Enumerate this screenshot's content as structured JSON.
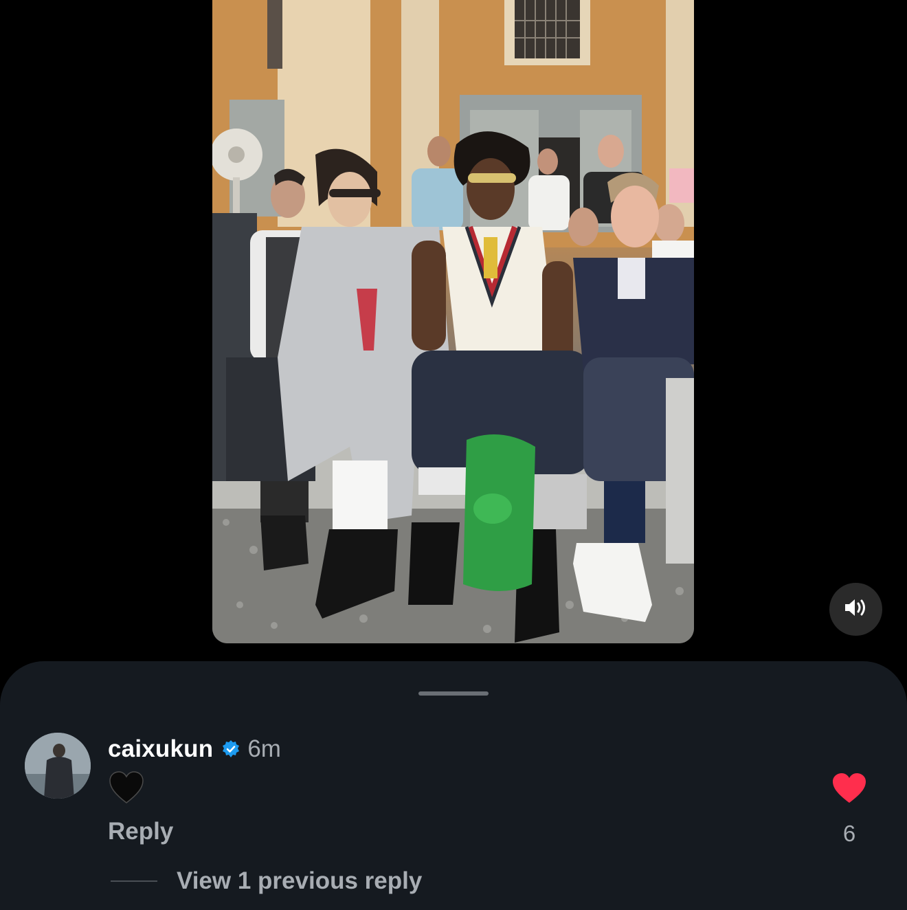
{
  "video": {
    "sound_icon": "speaker-on-icon"
  },
  "comment": {
    "username": "caixukun",
    "verified_icon": "verified-badge-icon",
    "time": "6m",
    "text_icon": "black-heart-emoji",
    "reply_label": "Reply",
    "like_icon": "heart-icon",
    "like_color": "#ff2e4d",
    "like_count": "6",
    "view_replies_label": "View 1 previous reply"
  },
  "colors": {
    "sheet_background": "#151a20",
    "verified_blue": "#1d9bf0",
    "secondary_text": "#a8adb3"
  }
}
